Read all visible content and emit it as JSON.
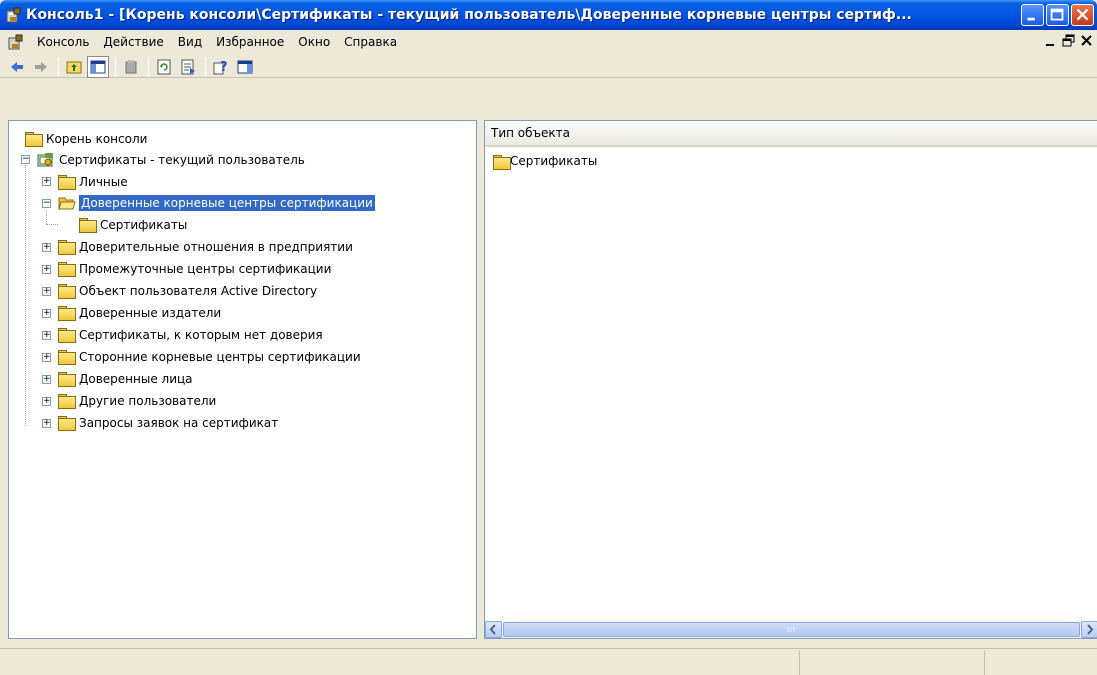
{
  "window": {
    "title": "Консоль1 - [Корень консоли\\Сертификаты - текущий пользователь\\Доверенные корневые центры сертиф...",
    "icon": "mmc-icon",
    "buttons": [
      "minimize",
      "maximize",
      "close"
    ]
  },
  "menu": {
    "items": [
      "Консоль",
      "Действие",
      "Вид",
      "Избранное",
      "Окно",
      "Справка"
    ],
    "mdi_buttons": [
      "_",
      "🗗",
      "✕"
    ]
  },
  "toolbar": {
    "buttons": [
      "back-icon",
      "forward-icon",
      "up-level-icon",
      "show-hide-tree-icon",
      "delete-icon",
      "refresh-icon",
      "export-list-icon",
      "help-icon",
      "show-hide-action-pane-icon"
    ]
  },
  "tree": {
    "root": "Корень консоли",
    "snapin": "Сертификаты - текущий пользователь",
    "items": [
      {
        "label": "Личные",
        "expanded": false
      },
      {
        "label": "Доверенные корневые центры сертификации",
        "expanded": true,
        "selected": true,
        "children": [
          "Сертификаты"
        ]
      },
      {
        "label": "Доверительные отношения в предприятии",
        "expanded": false
      },
      {
        "label": "Промежуточные центры сертификации",
        "expanded": false
      },
      {
        "label": "Объект пользователя Active Directory",
        "expanded": false
      },
      {
        "label": "Доверенные издатели",
        "expanded": false
      },
      {
        "label": "Сертификаты, к которым нет доверия",
        "expanded": false
      },
      {
        "label": "Сторонние корневые центры сертификации",
        "expanded": false
      },
      {
        "label": "Доверенные лица",
        "expanded": false
      },
      {
        "label": "Другие пользователи",
        "expanded": false
      },
      {
        "label": "Запросы заявок на сертификат",
        "expanded": false
      }
    ]
  },
  "detail": {
    "column_header": "Тип объекта",
    "rows": [
      "Сертификаты"
    ]
  },
  "colors": {
    "selection": "#316ac5",
    "titlebar": "#0055e5"
  }
}
